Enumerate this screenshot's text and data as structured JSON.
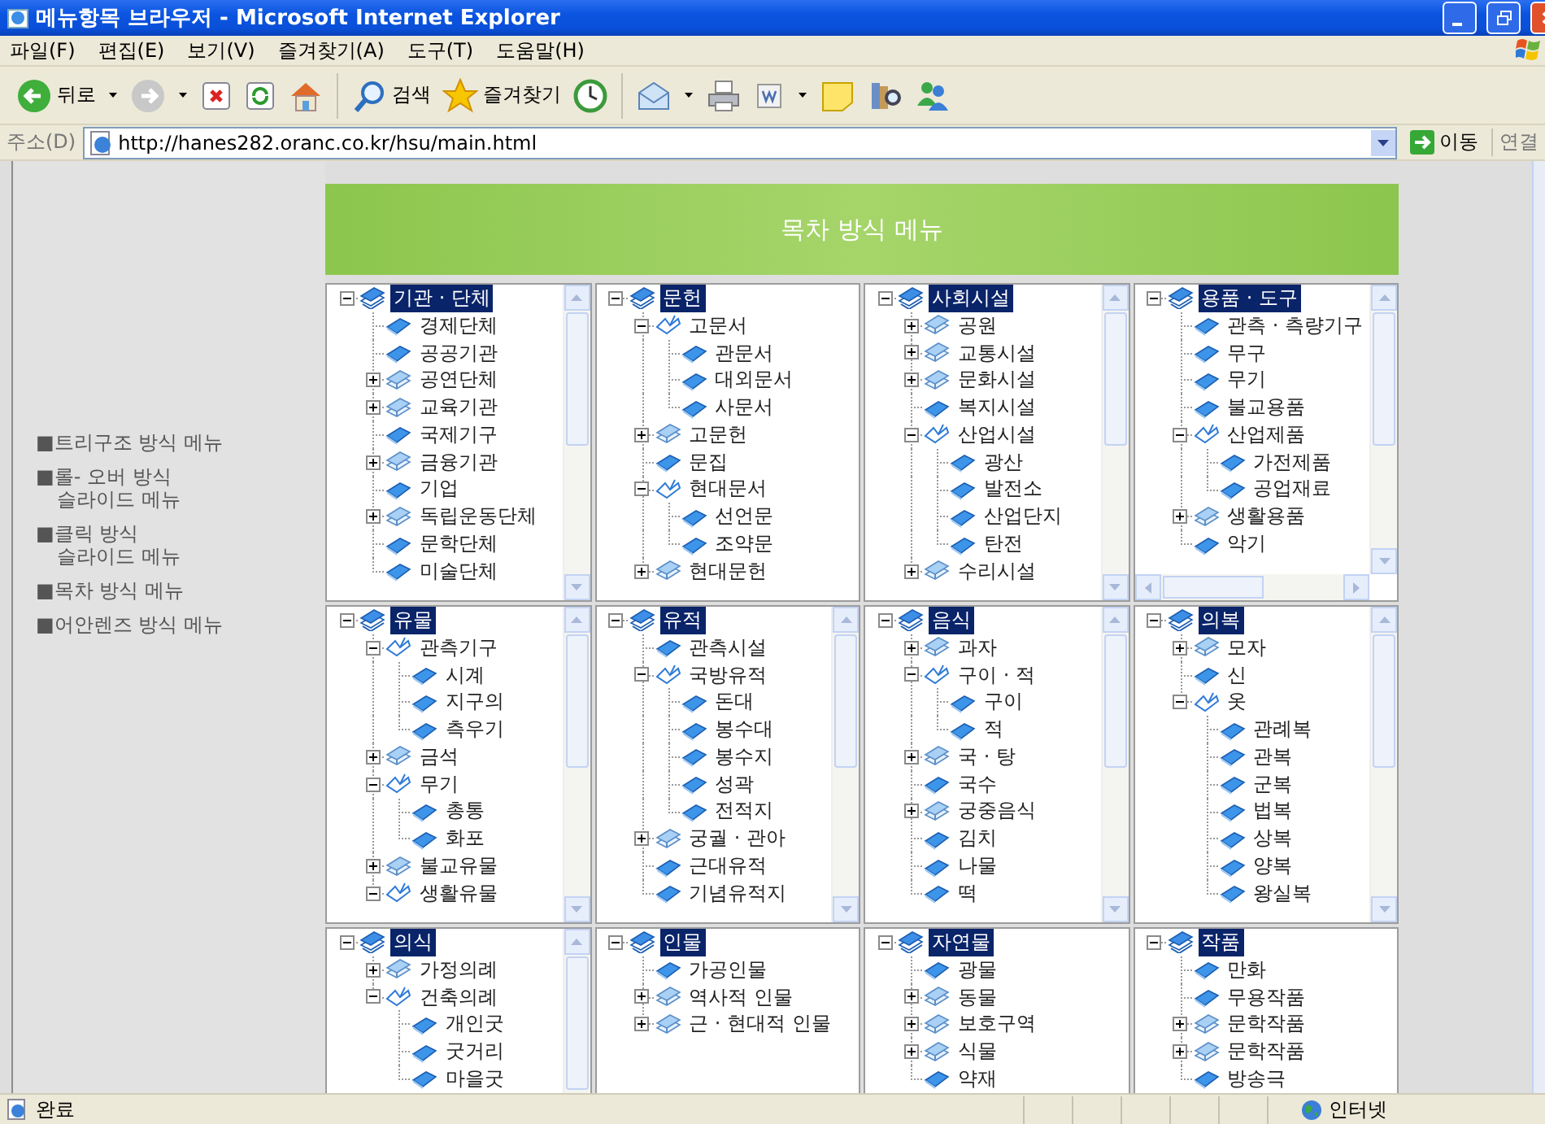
{
  "window": {
    "title": "메뉴항목 브라우저 - Microsoft Internet Explorer"
  },
  "menu": [
    "파일(F)",
    "편집(E)",
    "보기(V)",
    "즐겨찾기(A)",
    "도구(T)",
    "도움말(H)"
  ],
  "toolbar": {
    "groups": [
      [
        {
          "kind": "back",
          "label": "뒤로",
          "dropdown": true
        },
        {
          "kind": "forward",
          "dropdown": true
        },
        {
          "kind": "stop",
          "dropdown": false
        },
        {
          "kind": "refresh",
          "dropdown": false
        },
        {
          "kind": "home",
          "dropdown": false
        }
      ],
      [
        {
          "kind": "search",
          "label": "검색",
          "dropdown": false
        },
        {
          "kind": "favorites",
          "label": "즐겨찾기",
          "dropdown": false
        },
        {
          "kind": "history",
          "dropdown": false
        }
      ],
      [
        {
          "kind": "mail",
          "dropdown": true
        },
        {
          "kind": "print",
          "dropdown": false
        },
        {
          "kind": "edit",
          "dropdown": true
        },
        {
          "kind": "note",
          "dropdown": false
        },
        {
          "kind": "research",
          "dropdown": false
        },
        {
          "kind": "messenger",
          "dropdown": false
        }
      ]
    ]
  },
  "address": {
    "label": "주소(D)",
    "url": "http://hanes282.oranc.co.kr/hsu/main.html",
    "go": "이동",
    "links": "연결"
  },
  "sidebar": {
    "items": [
      "■트리구조 방식 메뉴",
      "■롤- 오버 방식\n슬라이드 메뉴",
      "■클릭 방식\n슬라이드 메뉴",
      "■목차 방식 메뉴",
      "■어안렌즈 방식 메뉴"
    ]
  },
  "banner": {
    "title": "목차 방식 메뉴"
  },
  "trees": [
    {
      "vscroll": true,
      "hscroll": false,
      "root": {
        "label": "기관 · 단체",
        "kind": "root",
        "selected": true,
        "expanded": true,
        "children": [
          {
            "label": "경제단체",
            "kind": "leaf"
          },
          {
            "label": "공공기관",
            "kind": "leaf"
          },
          {
            "label": "공연단체",
            "kind": "folder",
            "expanded": false
          },
          {
            "label": "교육기관",
            "kind": "folder",
            "expanded": false
          },
          {
            "label": "국제기구",
            "kind": "leaf"
          },
          {
            "label": "금융기관",
            "kind": "folder",
            "expanded": false
          },
          {
            "label": "기업",
            "kind": "leaf"
          },
          {
            "label": "독립운동단체",
            "kind": "folder",
            "expanded": false
          },
          {
            "label": "문학단체",
            "kind": "leaf"
          },
          {
            "label": "미술단체",
            "kind": "leaf"
          }
        ]
      }
    },
    {
      "vscroll": false,
      "hscroll": false,
      "root": {
        "label": "문헌",
        "kind": "root",
        "selected": true,
        "expanded": true,
        "children": [
          {
            "label": "고문서",
            "kind": "folder",
            "expanded": true,
            "children": [
              {
                "label": "관문서",
                "kind": "leaf"
              },
              {
                "label": "대외문서",
                "kind": "leaf"
              },
              {
                "label": "사문서",
                "kind": "leaf"
              }
            ]
          },
          {
            "label": "고문헌",
            "kind": "folder",
            "expanded": false
          },
          {
            "label": "문집",
            "kind": "leaf"
          },
          {
            "label": "현대문서",
            "kind": "folder",
            "expanded": true,
            "children": [
              {
                "label": "선언문",
                "kind": "leaf"
              },
              {
                "label": "조약문",
                "kind": "leaf"
              }
            ]
          },
          {
            "label": "현대문헌",
            "kind": "folder",
            "expanded": false
          }
        ]
      }
    },
    {
      "vscroll": true,
      "hscroll": false,
      "root": {
        "label": "사회시설",
        "kind": "root",
        "selected": true,
        "expanded": true,
        "children": [
          {
            "label": "공원",
            "kind": "folder",
            "expanded": false
          },
          {
            "label": "교통시설",
            "kind": "folder",
            "expanded": false
          },
          {
            "label": "문화시설",
            "kind": "folder",
            "expanded": false
          },
          {
            "label": "복지시설",
            "kind": "leaf"
          },
          {
            "label": "산업시설",
            "kind": "folder",
            "expanded": true,
            "children": [
              {
                "label": "광산",
                "kind": "leaf"
              },
              {
                "label": "발전소",
                "kind": "leaf"
              },
              {
                "label": "산업단지",
                "kind": "leaf"
              },
              {
                "label": "탄전",
                "kind": "leaf"
              }
            ]
          },
          {
            "label": "수리시설",
            "kind": "folder",
            "expanded": false
          }
        ]
      }
    },
    {
      "vscroll": true,
      "hscroll": true,
      "root": {
        "label": "용품 · 도구",
        "kind": "root",
        "selected": true,
        "expanded": true,
        "children": [
          {
            "label": "관측 · 측량기구",
            "kind": "leaf"
          },
          {
            "label": "무구",
            "kind": "leaf"
          },
          {
            "label": "무기",
            "kind": "leaf"
          },
          {
            "label": "불교용품",
            "kind": "leaf"
          },
          {
            "label": "산업제품",
            "kind": "folder",
            "expanded": true,
            "children": [
              {
                "label": "가전제품",
                "kind": "leaf"
              },
              {
                "label": "공업재료",
                "kind": "leaf"
              }
            ]
          },
          {
            "label": "생활용품",
            "kind": "folder",
            "expanded": false
          },
          {
            "label": "악기",
            "kind": "leaf"
          }
        ]
      }
    },
    {
      "vscroll": true,
      "hscroll": false,
      "root": {
        "label": "유물",
        "kind": "root",
        "selected": true,
        "expanded": true,
        "children": [
          {
            "label": "관측기구",
            "kind": "folder",
            "expanded": true,
            "children": [
              {
                "label": "시계",
                "kind": "leaf"
              },
              {
                "label": "지구의",
                "kind": "leaf"
              },
              {
                "label": "측우기",
                "kind": "leaf"
              }
            ]
          },
          {
            "label": "금석",
            "kind": "folder",
            "expanded": false
          },
          {
            "label": "무기",
            "kind": "folder",
            "expanded": true,
            "children": [
              {
                "label": "총통",
                "kind": "leaf"
              },
              {
                "label": "화포",
                "kind": "leaf"
              }
            ]
          },
          {
            "label": "불교유물",
            "kind": "folder",
            "expanded": false
          },
          {
            "label": "생활유물",
            "kind": "folder",
            "expanded": true
          }
        ]
      }
    },
    {
      "vscroll": true,
      "hscroll": false,
      "root": {
        "label": "유적",
        "kind": "root",
        "selected": true,
        "expanded": true,
        "children": [
          {
            "label": "관측시설",
            "kind": "leaf"
          },
          {
            "label": "국방유적",
            "kind": "folder",
            "expanded": true,
            "children": [
              {
                "label": "돈대",
                "kind": "leaf"
              },
              {
                "label": "봉수대",
                "kind": "leaf"
              },
              {
                "label": "봉수지",
                "kind": "leaf"
              },
              {
                "label": "성곽",
                "kind": "leaf"
              },
              {
                "label": "전적지",
                "kind": "leaf"
              }
            ]
          },
          {
            "label": "궁궐 · 관아",
            "kind": "folder",
            "expanded": false
          },
          {
            "label": "근대유적",
            "kind": "leaf"
          },
          {
            "label": "기념유적지",
            "kind": "leaf"
          }
        ]
      }
    },
    {
      "vscroll": true,
      "hscroll": false,
      "root": {
        "label": "음식",
        "kind": "root",
        "selected": true,
        "expanded": true,
        "children": [
          {
            "label": "과자",
            "kind": "folder",
            "expanded": false
          },
          {
            "label": "구이 · 적",
            "kind": "folder",
            "expanded": true,
            "children": [
              {
                "label": "구이",
                "kind": "leaf"
              },
              {
                "label": "적",
                "kind": "leaf"
              }
            ]
          },
          {
            "label": "국 · 탕",
            "kind": "folder",
            "expanded": false
          },
          {
            "label": "국수",
            "kind": "leaf"
          },
          {
            "label": "궁중음식",
            "kind": "folder",
            "expanded": false
          },
          {
            "label": "김치",
            "kind": "leaf"
          },
          {
            "label": "나물",
            "kind": "leaf"
          },
          {
            "label": "떡",
            "kind": "leaf"
          }
        ]
      }
    },
    {
      "vscroll": true,
      "hscroll": false,
      "root": {
        "label": "의복",
        "kind": "root",
        "selected": true,
        "expanded": true,
        "children": [
          {
            "label": "모자",
            "kind": "folder",
            "expanded": false
          },
          {
            "label": "신",
            "kind": "leaf"
          },
          {
            "label": "옷",
            "kind": "folder",
            "expanded": true,
            "children": [
              {
                "label": "관례복",
                "kind": "leaf"
              },
              {
                "label": "관복",
                "kind": "leaf"
              },
              {
                "label": "군복",
                "kind": "leaf"
              },
              {
                "label": "법복",
                "kind": "leaf"
              },
              {
                "label": "상복",
                "kind": "leaf"
              },
              {
                "label": "양복",
                "kind": "leaf"
              },
              {
                "label": "왕실복",
                "kind": "leaf"
              }
            ]
          }
        ]
      }
    },
    {
      "vscroll": true,
      "hscroll": false,
      "root": {
        "label": "의식",
        "kind": "root",
        "selected": true,
        "expanded": true,
        "children": [
          {
            "label": "가정의례",
            "kind": "folder",
            "expanded": false
          },
          {
            "label": "건축의례",
            "kind": "folder",
            "expanded": true,
            "children": [
              {
                "label": "개인굿",
                "kind": "leaf"
              },
              {
                "label": "굿거리",
                "kind": "leaf"
              },
              {
                "label": "마을굿",
                "kind": "leaf"
              }
            ]
          }
        ]
      }
    },
    {
      "vscroll": false,
      "hscroll": false,
      "root": {
        "label": "인물",
        "kind": "root",
        "selected": true,
        "expanded": true,
        "children": [
          {
            "label": "가공인물",
            "kind": "leaf"
          },
          {
            "label": "역사적 인물",
            "kind": "folder",
            "expanded": false
          },
          {
            "label": "근 · 현대적 인물",
            "kind": "folder",
            "expanded": false
          }
        ]
      }
    },
    {
      "vscroll": false,
      "hscroll": false,
      "root": {
        "label": "자연물",
        "kind": "root",
        "selected": true,
        "expanded": true,
        "children": [
          {
            "label": "광물",
            "kind": "leaf"
          },
          {
            "label": "동물",
            "kind": "folder",
            "expanded": false
          },
          {
            "label": "보호구역",
            "kind": "folder",
            "expanded": false
          },
          {
            "label": "식물",
            "kind": "folder",
            "expanded": false
          },
          {
            "label": "약재",
            "kind": "leaf"
          }
        ]
      }
    },
    {
      "vscroll": false,
      "hscroll": false,
      "root": {
        "label": "작품",
        "kind": "root",
        "selected": true,
        "expanded": true,
        "children": [
          {
            "label": "만화",
            "kind": "leaf"
          },
          {
            "label": "무용작품",
            "kind": "leaf"
          },
          {
            "label": "문학작품",
            "kind": "folder",
            "expanded": false
          },
          {
            "label": "문학작품",
            "kind": "folder",
            "expanded": false
          },
          {
            "label": "방송극",
            "kind": "leaf"
          }
        ]
      }
    }
  ],
  "status_bar": {
    "text": "완료",
    "zone": "인터넷"
  }
}
